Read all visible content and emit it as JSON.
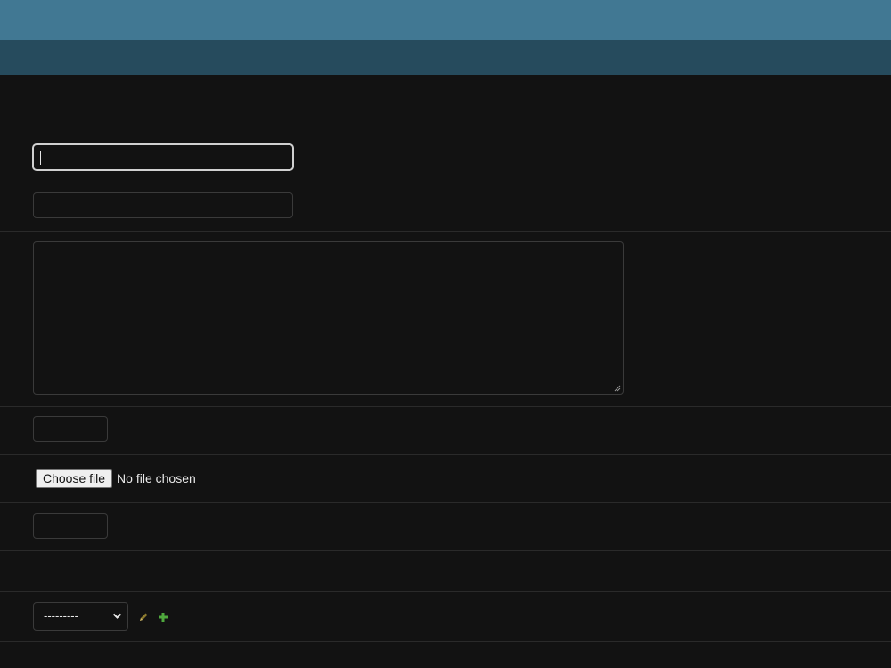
{
  "file_input": {
    "button_label": "Choose file",
    "status_text": "No file chosen"
  },
  "related_select": {
    "selected_value": "---------"
  },
  "icons": {
    "edit": "pencil-icon",
    "add": "plus-icon"
  },
  "colors": {
    "header_primary": "#417893",
    "header_secondary": "#264b5d",
    "background": "#121212",
    "edit_icon": "#8c7a2e",
    "add_icon": "#4fa83d"
  }
}
